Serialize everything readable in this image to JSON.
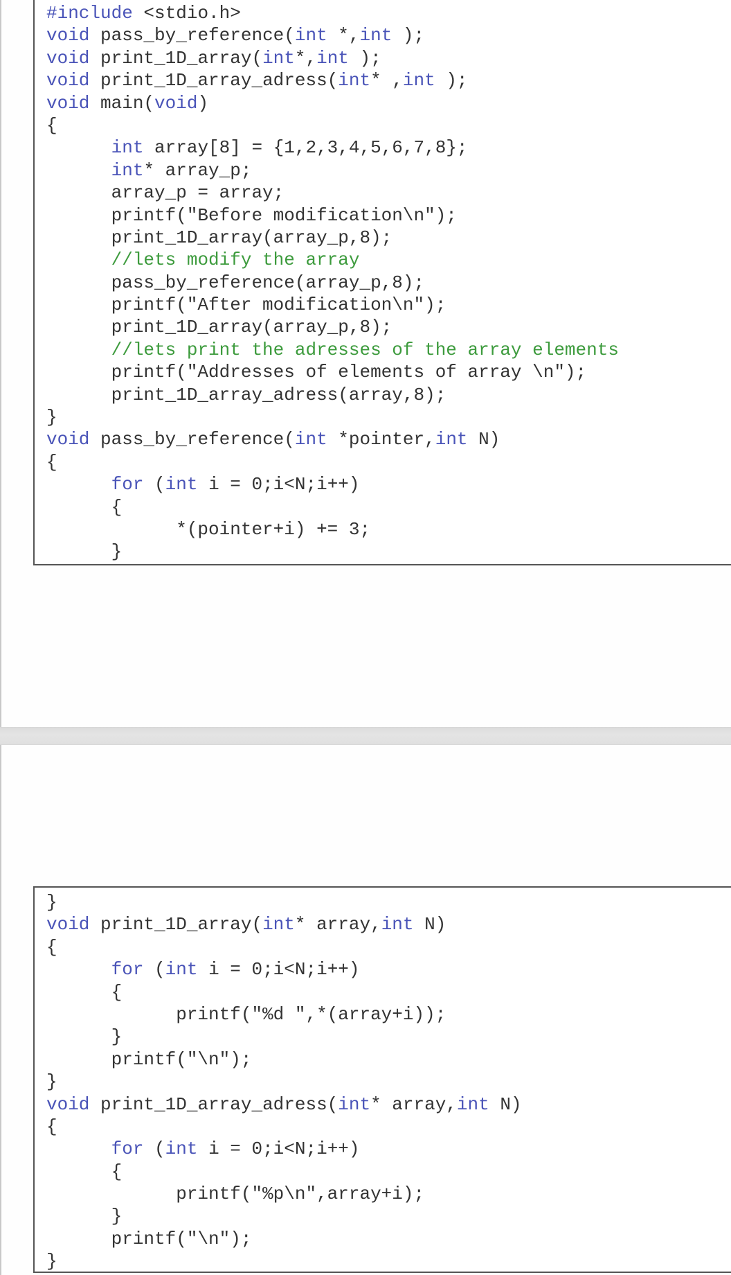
{
  "document": {
    "colors": {
      "keyword": "#4a54b8",
      "comment": "#3d9b3d",
      "text": "#333333",
      "border": "#555555",
      "separator": "#e0e0e0"
    },
    "snippets": [
      {
        "lines": [
          [
            {
              "t": "pp",
              "v": "#include"
            },
            {
              "t": "tx",
              "v": " <stdio.h>"
            }
          ],
          [
            {
              "t": "kw",
              "v": "void"
            },
            {
              "t": "tx",
              "v": " pass_by_reference("
            },
            {
              "t": "kw",
              "v": "int"
            },
            {
              "t": "tx",
              "v": " *,"
            },
            {
              "t": "kw",
              "v": "int"
            },
            {
              "t": "tx",
              "v": " );"
            }
          ],
          [
            {
              "t": "kw",
              "v": "void"
            },
            {
              "t": "tx",
              "v": " print_1D_array("
            },
            {
              "t": "kw",
              "v": "int"
            },
            {
              "t": "tx",
              "v": "*,"
            },
            {
              "t": "kw",
              "v": "int"
            },
            {
              "t": "tx",
              "v": " );"
            }
          ],
          [
            {
              "t": "kw",
              "v": "void"
            },
            {
              "t": "tx",
              "v": " print_1D_array_adress("
            },
            {
              "t": "kw",
              "v": "int"
            },
            {
              "t": "tx",
              "v": "* ,"
            },
            {
              "t": "kw",
              "v": "int"
            },
            {
              "t": "tx",
              "v": " );"
            }
          ],
          [
            {
              "t": "kw",
              "v": "void"
            },
            {
              "t": "tx",
              "v": " main("
            },
            {
              "t": "kw",
              "v": "void"
            },
            {
              "t": "tx",
              "v": ")"
            }
          ],
          [
            {
              "t": "tx",
              "v": "{"
            }
          ],
          [
            {
              "t": "tx",
              "v": "      "
            },
            {
              "t": "kw",
              "v": "int"
            },
            {
              "t": "tx",
              "v": " array[8] = {1,2,3,4,5,6,7,8};"
            }
          ],
          [
            {
              "t": "tx",
              "v": "      "
            },
            {
              "t": "kw",
              "v": "int"
            },
            {
              "t": "tx",
              "v": "* array_p;"
            }
          ],
          [
            {
              "t": "tx",
              "v": "      array_p = array;"
            }
          ],
          [
            {
              "t": "tx",
              "v": "      printf(\"Before modification\\n\");"
            }
          ],
          [
            {
              "t": "tx",
              "v": "      print_1D_array(array_p,8);"
            }
          ],
          [
            {
              "t": "tx",
              "v": "      "
            },
            {
              "t": "cm",
              "v": "//lets modify the array"
            }
          ],
          [
            {
              "t": "tx",
              "v": "      pass_by_reference(array_p,8);"
            }
          ],
          [
            {
              "t": "tx",
              "v": "      printf(\"After modification\\n\");"
            }
          ],
          [
            {
              "t": "tx",
              "v": "      print_1D_array(array_p,8);"
            }
          ],
          [
            {
              "t": "tx",
              "v": "      "
            },
            {
              "t": "cm",
              "v": "//lets print the adresses of the array elements"
            }
          ],
          [
            {
              "t": "tx",
              "v": "      printf(\"Addresses of elements of array \\n\");"
            }
          ],
          [
            {
              "t": "tx",
              "v": "      print_1D_array_adress(array,8);"
            }
          ],
          [
            {
              "t": "tx",
              "v": "}"
            }
          ],
          [
            {
              "t": "kw",
              "v": "void"
            },
            {
              "t": "tx",
              "v": " pass_by_reference("
            },
            {
              "t": "kw",
              "v": "int"
            },
            {
              "t": "tx",
              "v": " *pointer,"
            },
            {
              "t": "kw",
              "v": "int"
            },
            {
              "t": "tx",
              "v": " N)"
            }
          ],
          [
            {
              "t": "tx",
              "v": "{"
            }
          ],
          [
            {
              "t": "tx",
              "v": "      "
            },
            {
              "t": "kw",
              "v": "for"
            },
            {
              "t": "tx",
              "v": " ("
            },
            {
              "t": "kw",
              "v": "int"
            },
            {
              "t": "tx",
              "v": " i = 0;i<N;i++)"
            }
          ],
          [
            {
              "t": "tx",
              "v": "      {"
            }
          ],
          [
            {
              "t": "tx",
              "v": "            *(pointer+i) += 3;"
            }
          ],
          [
            {
              "t": "tx",
              "v": "      }"
            }
          ]
        ]
      },
      {
        "lines": [
          [
            {
              "t": "tx",
              "v": "}"
            }
          ],
          [
            {
              "t": "kw",
              "v": "void"
            },
            {
              "t": "tx",
              "v": " print_1D_array("
            },
            {
              "t": "kw",
              "v": "int"
            },
            {
              "t": "tx",
              "v": "* array,"
            },
            {
              "t": "kw",
              "v": "int"
            },
            {
              "t": "tx",
              "v": " N)"
            }
          ],
          [
            {
              "t": "tx",
              "v": "{"
            }
          ],
          [
            {
              "t": "tx",
              "v": "      "
            },
            {
              "t": "kw",
              "v": "for"
            },
            {
              "t": "tx",
              "v": " ("
            },
            {
              "t": "kw",
              "v": "int"
            },
            {
              "t": "tx",
              "v": " i = 0;i<N;i++)"
            }
          ],
          [
            {
              "t": "tx",
              "v": "      {"
            }
          ],
          [
            {
              "t": "tx",
              "v": "            printf(\"%d \",*(array+i));"
            }
          ],
          [
            {
              "t": "tx",
              "v": "      }"
            }
          ],
          [
            {
              "t": "tx",
              "v": "      printf(\"\\n\");"
            }
          ],
          [
            {
              "t": "tx",
              "v": "}"
            }
          ],
          [
            {
              "t": "kw",
              "v": "void"
            },
            {
              "t": "tx",
              "v": " print_1D_array_adress("
            },
            {
              "t": "kw",
              "v": "int"
            },
            {
              "t": "tx",
              "v": "* array,"
            },
            {
              "t": "kw",
              "v": "int"
            },
            {
              "t": "tx",
              "v": " N)"
            }
          ],
          [
            {
              "t": "tx",
              "v": "{"
            }
          ],
          [
            {
              "t": "tx",
              "v": "      "
            },
            {
              "t": "kw",
              "v": "for"
            },
            {
              "t": "tx",
              "v": " ("
            },
            {
              "t": "kw",
              "v": "int"
            },
            {
              "t": "tx",
              "v": " i = 0;i<N;i++)"
            }
          ],
          [
            {
              "t": "tx",
              "v": "      {"
            }
          ],
          [
            {
              "t": "tx",
              "v": "            printf(\"%p\\n\",array+i);"
            }
          ],
          [
            {
              "t": "tx",
              "v": "      }"
            }
          ],
          [
            {
              "t": "tx",
              "v": "      printf(\"\\n\");"
            }
          ],
          [
            {
              "t": "tx",
              "v": "}"
            }
          ]
        ]
      }
    ]
  }
}
